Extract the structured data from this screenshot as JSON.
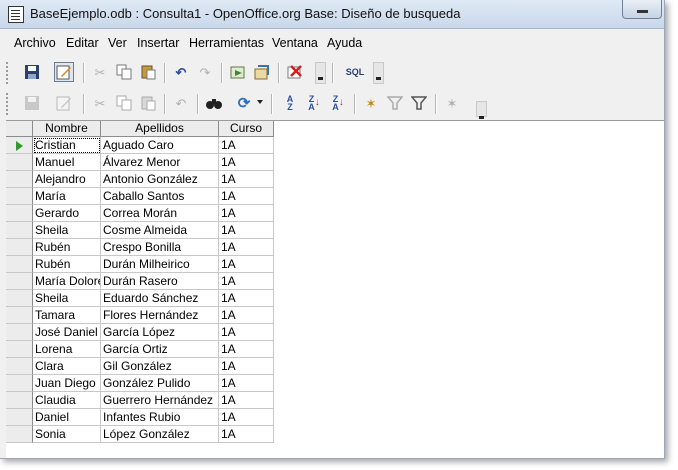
{
  "window": {
    "title": "BaseEjemplo.odb : Consulta1 - OpenOffice.org Base: Diseño de busqueda"
  },
  "menu": [
    "Archivo",
    "Editar",
    "Ver",
    "Insertar",
    "Herramientas",
    "Ventana",
    "Ayuda"
  ],
  "toolbar1": {
    "buttons": [
      "save-icon",
      "edit-mode-icon",
      "cut-icon",
      "copy-icon",
      "paste-icon",
      "undo-icon",
      "redo-icon",
      "run-query-icon",
      "add-tables-icon",
      "delete-icon",
      "sql-icon"
    ],
    "sql_label": "SQL"
  },
  "toolbar2": {
    "buttons": [
      "save-record-icon",
      "edit-data-icon",
      "cut-icon",
      "copy-icon",
      "paste-icon",
      "undo-icon",
      "find-record-icon",
      "refresh-icon",
      "sort-ascending-icon",
      "sort-descending-icon",
      "sort-icon",
      "autofilter-icon",
      "standard-filter-icon",
      "apply-filter-icon",
      "remove-filter-icon"
    ]
  },
  "table": {
    "columns": [
      "Nombre",
      "Apellidos",
      "Curso"
    ],
    "rows": [
      [
        "Cristian",
        "Aguado Caro",
        "1A"
      ],
      [
        "Manuel",
        "Álvarez Menor",
        "1A"
      ],
      [
        "Alejandro",
        "Antonio González",
        "1A"
      ],
      [
        "María",
        "Caballo Santos",
        "1A"
      ],
      [
        "Gerardo",
        "Correa Morán",
        "1A"
      ],
      [
        "Sheila",
        "Cosme Almeida",
        "1A"
      ],
      [
        "Rubén",
        "Crespo Bonilla",
        "1A"
      ],
      [
        "Rubén",
        "Durán Milheirico",
        "1A"
      ],
      [
        "María Dolores",
        "Durán Rasero",
        "1A"
      ],
      [
        "Sheila",
        "Eduardo Sánchez",
        "1A"
      ],
      [
        "Tamara",
        "Flores Hernández",
        "1A"
      ],
      [
        "José Daniel",
        "García López",
        "1A"
      ],
      [
        "Lorena",
        "García Ortiz",
        "1A"
      ],
      [
        "Clara",
        "Gil González",
        "1A"
      ],
      [
        "Juan Diego",
        "González Pulido",
        "1A"
      ],
      [
        "Claudia",
        "Guerrero Hernández",
        "1A"
      ],
      [
        "Daniel",
        "Infantes Rubio",
        "1A"
      ],
      [
        "Sonia",
        "López González",
        "1A"
      ]
    ]
  }
}
